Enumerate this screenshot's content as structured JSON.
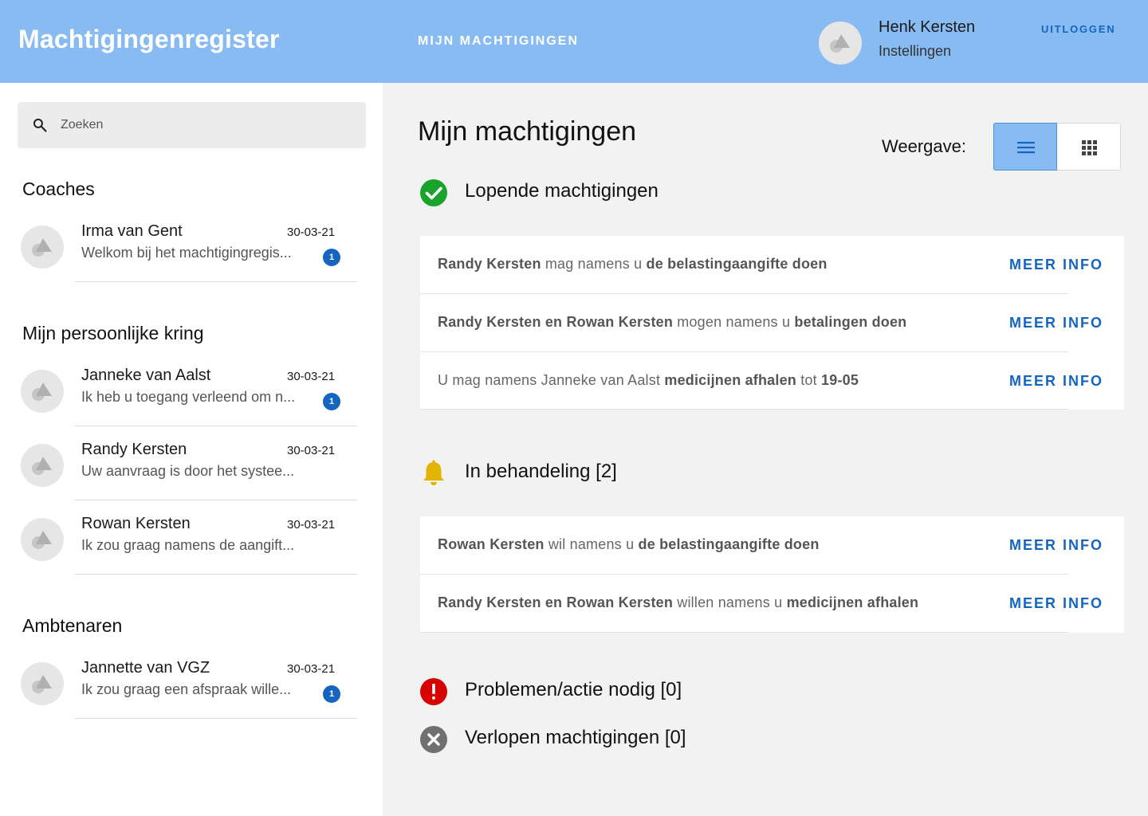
{
  "header": {
    "brand": "Machtigingenregister",
    "nav_label": "MIJN MACHTIGINGEN",
    "user_name": "Henk Kersten",
    "settings_label": "Instellingen",
    "logout_label": "UITLOGGEN",
    "color": "#87bbf2"
  },
  "sidebar": {
    "search": {
      "placeholder": "Zoeken",
      "value": ""
    },
    "sections": [
      {
        "title": "Coaches",
        "contacts": [
          {
            "name": "Irma van Gent",
            "date": "30-03-21",
            "message": "Welkom bij het machtigingregis...",
            "unread": "1"
          }
        ]
      },
      {
        "title": "Mijn persoonlijke kring",
        "contacts": [
          {
            "name": "Janneke van Aalst",
            "date": "30-03-21",
            "message": "Ik heb u toegang verleend om n...",
            "unread": "1"
          },
          {
            "name": "Randy Kersten",
            "date": "30-03-21",
            "message": "Uw aanvraag is door het systee...",
            "unread": ""
          },
          {
            "name": "Rowan Kersten",
            "date": "30-03-21",
            "message": "Ik zou graag namens de aangift...",
            "unread": ""
          }
        ]
      },
      {
        "title": "Ambtenaren",
        "contacts": [
          {
            "name": "Jannette van VGZ",
            "date": "30-03-21",
            "message": "Ik zou graag een afspraak wille...",
            "unread": "1"
          }
        ]
      }
    ]
  },
  "main": {
    "title": "Mijn machtigingen",
    "view_label": "Weergave:",
    "view_selected": "list",
    "more_label": "MEER INFO",
    "running": {
      "title": "Lopende machtigingen",
      "icon": "check-circle-icon",
      "color": "#1aa32a",
      "rows": [
        {
          "who": "Randy Kersten",
          "verb": " mag namens u ",
          "what": "de belastingaangifte doen",
          "tail": "",
          "tail_bold": ""
        },
        {
          "who": "Randy Kersten en Rowan Kersten",
          "verb": " mogen namens u ",
          "what": "betalingen doen",
          "tail": "",
          "tail_bold": ""
        },
        {
          "who": "",
          "verb": "U mag namens Janneke van Aalst ",
          "what": "medicijnen afhalen",
          "tail": " tot ",
          "tail_bold": "19-05"
        }
      ]
    },
    "pending": {
      "title": "In behandeling [2]",
      "icon": "bell-icon",
      "color": "#e0b400",
      "rows": [
        {
          "who": "Rowan Kersten",
          "verb": " wil namens u ",
          "what": "de belastingaangifte doen",
          "tail": "",
          "tail_bold": ""
        },
        {
          "who": "Randy Kersten en Rowan Kersten",
          "verb": " willen namens u ",
          "what": "medicijnen afhalen",
          "tail": "",
          "tail_bold": ""
        }
      ]
    },
    "problems": {
      "title": "Problemen/actie nodig [0]",
      "icon": "alert-circle-icon",
      "color": "#d50000"
    },
    "expired": {
      "title": "Verlopen machtigingen [0]",
      "icon": "close-circle-icon",
      "color": "#707070"
    }
  }
}
